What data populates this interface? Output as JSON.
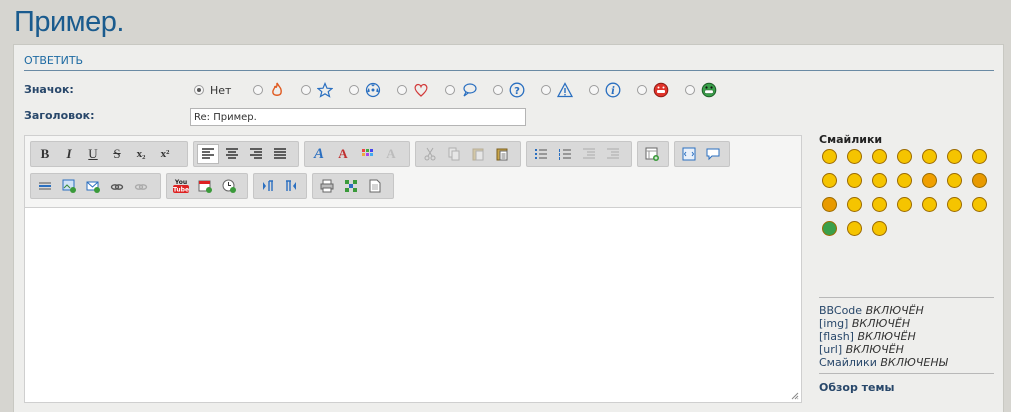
{
  "page": {
    "title": "Пример."
  },
  "section": {
    "title": "ОТВЕТИТЬ"
  },
  "form": {
    "icon_label": "Значок:",
    "icon_none_label": "Нет",
    "icons": [
      "fire-icon",
      "star-icon",
      "radiation-icon",
      "heart-icon",
      "speech-bubble-icon",
      "question-icon",
      "warning-icon",
      "info-icon",
      "angry-face-icon",
      "grin-face-icon"
    ],
    "subject_label": "Заголовок:",
    "subject_value": "Re: Пример."
  },
  "toolbar": {
    "bold": "B",
    "italic": "I",
    "underline": "U",
    "strike": "S",
    "subscript": "x₂",
    "superscript": "x²",
    "youtube_label": "You Tube"
  },
  "sidebar": {
    "smilies_title": "Смайлики",
    "options": [
      {
        "name": "BBCode",
        "state": "ВКЛЮЧЁН"
      },
      {
        "name": "[img]",
        "state": "ВКЛЮЧЁН"
      },
      {
        "name": "[flash]",
        "state": "ВКЛЮЧЁН"
      },
      {
        "name": "[url]",
        "state": "ВКЛЮЧЁН"
      },
      {
        "name": "Смайлики",
        "state": "ВКЛЮЧЕНЫ"
      }
    ],
    "review_link": "Обзор темы"
  },
  "colors": {
    "title_blue": "#1a5b8e",
    "link_blue": "#28476a",
    "smiley_yellow": "#f5c400",
    "smiley_green": "#3aa04a"
  }
}
